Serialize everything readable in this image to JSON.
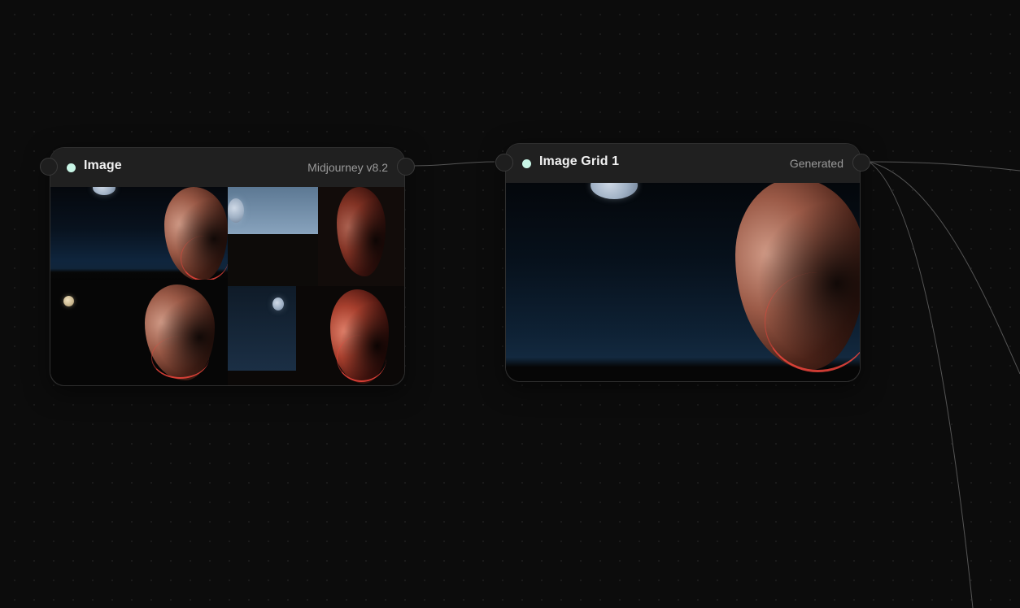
{
  "nodes": [
    {
      "title": "Image",
      "subtitle": "Midjourney v8.2",
      "status_color": "#c8f5e6",
      "content": "2x2 grid of moonlit portrait variations"
    },
    {
      "title": "Image Grid 1",
      "subtitle": "Generated",
      "status_color": "#c8f5e6",
      "content": "single moonlit portrait"
    }
  ],
  "icons": {
    "status": "status-dot-icon",
    "port": "connection-port-icon"
  },
  "colors": {
    "canvas_bg": "#0c0c0c",
    "node_bg": "#1b1b1b",
    "accent": "#c8f5e6",
    "wire": "#5a5a5a"
  }
}
